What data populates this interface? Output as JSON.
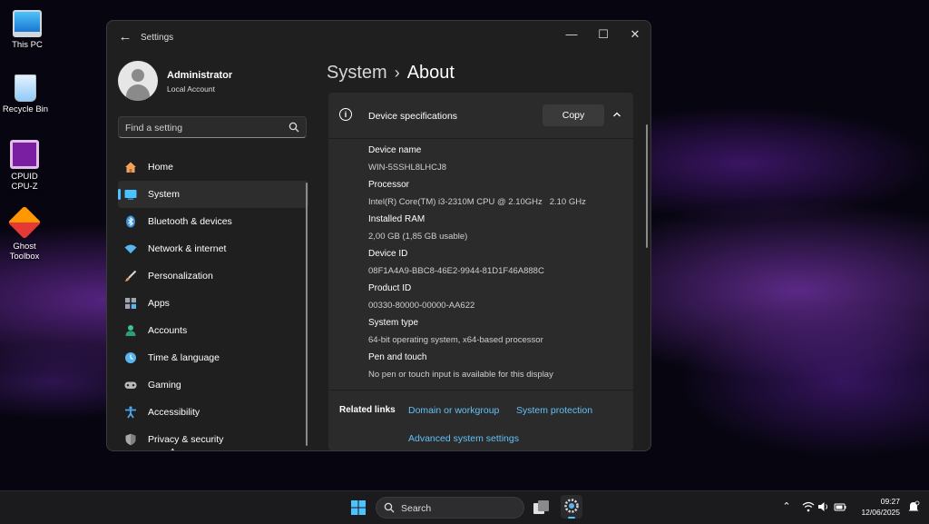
{
  "desktop": {
    "icons": [
      {
        "label": "This PC"
      },
      {
        "label": "Recycle Bin"
      },
      {
        "label": "CPUID\nCPU-Z"
      },
      {
        "label": "Ghost\nToolbox"
      }
    ]
  },
  "window": {
    "title": "Settings",
    "controls": {
      "minimize": "—",
      "maximize": "☐",
      "close": "✕"
    }
  },
  "account": {
    "name": "Administrator",
    "type": "Local Account"
  },
  "search": {
    "placeholder": "Find a setting"
  },
  "nav": {
    "items": [
      {
        "label": "Home",
        "icon": "home-icon",
        "color": "#f0a35e"
      },
      {
        "label": "System",
        "icon": "system-icon",
        "color": "#4cc2ff",
        "active": true
      },
      {
        "label": "Bluetooth & devices",
        "icon": "bluetooth-icon",
        "color": "#3a96dd"
      },
      {
        "label": "Network & internet",
        "icon": "wifi-icon",
        "color": "#5ab4f0"
      },
      {
        "label": "Personalization",
        "icon": "brush-icon",
        "color": "#e89a5c"
      },
      {
        "label": "Apps",
        "icon": "apps-icon",
        "color": "#a0a6b0"
      },
      {
        "label": "Accounts",
        "icon": "accounts-icon",
        "color": "#3ec28f"
      },
      {
        "label": "Time & language",
        "icon": "time-language-icon",
        "color": "#5ab4f0"
      },
      {
        "label": "Gaming",
        "icon": "gamepad-icon",
        "color": "#b8b8b8"
      },
      {
        "label": "Accessibility",
        "icon": "accessibility-icon",
        "color": "#4aa8f0"
      },
      {
        "label": "Privacy & security",
        "icon": "shield-icon",
        "color": "#a8a8a8"
      }
    ]
  },
  "breadcrumb": {
    "parent": "System",
    "separator": "›",
    "current": "About"
  },
  "device_specs": {
    "title": "Device specifications",
    "copy_label": "Copy",
    "items": [
      {
        "label": "Device name",
        "value": "WIN-5SSHL8LHCJ8"
      },
      {
        "label": "Processor",
        "value": "Intel(R) Core(TM) i3-2310M CPU @ 2.10GHz   2.10 GHz"
      },
      {
        "label": "Installed RAM",
        "value": "2,00 GB (1,85 GB usable)"
      },
      {
        "label": "Device ID",
        "value": "08F1A4A9-BBC8-46E2-9944-81D1F46A888C"
      },
      {
        "label": "Product ID",
        "value": "00330-80000-00000-AA622"
      },
      {
        "label": "System type",
        "value": "64-bit operating system, x64-based processor"
      },
      {
        "label": "Pen and touch",
        "value": "No pen or touch input is available for this display"
      }
    ]
  },
  "related_links": {
    "label": "Related links",
    "domain": "Domain or workgroup",
    "protection": "System protection",
    "advanced": "Advanced system settings"
  },
  "taskbar": {
    "search_label": "Search",
    "time": "09:27",
    "date": "12/06/2025"
  },
  "colors": {
    "accent": "#4cc2ff",
    "link": "#62c0f5"
  }
}
